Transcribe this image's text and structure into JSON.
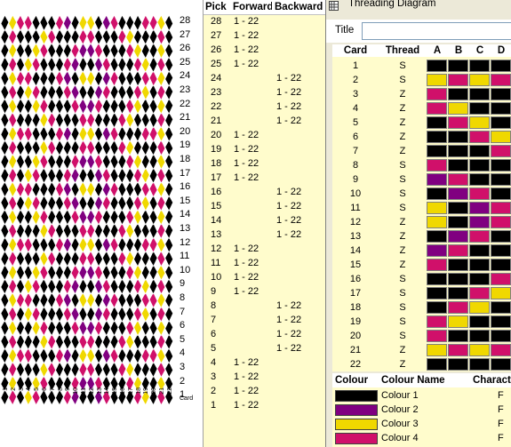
{
  "pattern": {
    "pick_labels": [
      "28",
      "27",
      "26",
      "25",
      "24",
      "23",
      "22",
      "21",
      "20",
      "19",
      "18",
      "17",
      "16",
      "15",
      "14",
      "13",
      "12",
      "11",
      "10",
      "9",
      "8",
      "7",
      "6",
      "5",
      "4",
      "3",
      "2",
      "1"
    ],
    "card_labels": [
      "1",
      "2",
      "3",
      "4",
      "5",
      "6",
      "7",
      "8",
      "9",
      "10",
      "11",
      "12",
      "13",
      "14",
      "15",
      "16",
      "17",
      "18",
      "19",
      "20",
      "21",
      "22"
    ],
    "card_word": "Card"
  },
  "pick_table": {
    "headers": [
      "Pick",
      "Forward",
      "Backward"
    ],
    "rows": [
      {
        "pick": "28",
        "fwd": "1 - 22",
        "bwd": ""
      },
      {
        "pick": "27",
        "fwd": "1 - 22",
        "bwd": ""
      },
      {
        "pick": "26",
        "fwd": "1 - 22",
        "bwd": ""
      },
      {
        "pick": "25",
        "fwd": "1 - 22",
        "bwd": ""
      },
      {
        "pick": "24",
        "fwd": "",
        "bwd": "1 - 22"
      },
      {
        "pick": "23",
        "fwd": "",
        "bwd": "1 - 22"
      },
      {
        "pick": "22",
        "fwd": "",
        "bwd": "1 - 22"
      },
      {
        "pick": "21",
        "fwd": "",
        "bwd": "1 - 22"
      },
      {
        "pick": "20",
        "fwd": "1 - 22",
        "bwd": ""
      },
      {
        "pick": "19",
        "fwd": "1 - 22",
        "bwd": ""
      },
      {
        "pick": "18",
        "fwd": "1 - 22",
        "bwd": ""
      },
      {
        "pick": "17",
        "fwd": "1 - 22",
        "bwd": ""
      },
      {
        "pick": "16",
        "fwd": "",
        "bwd": "1 - 22"
      },
      {
        "pick": "15",
        "fwd": "",
        "bwd": "1 - 22"
      },
      {
        "pick": "14",
        "fwd": "",
        "bwd": "1 - 22"
      },
      {
        "pick": "13",
        "fwd": "",
        "bwd": "1 - 22"
      },
      {
        "pick": "12",
        "fwd": "1 - 22",
        "bwd": ""
      },
      {
        "pick": "11",
        "fwd": "1 - 22",
        "bwd": ""
      },
      {
        "pick": "10",
        "fwd": "1 - 22",
        "bwd": ""
      },
      {
        "pick": "9",
        "fwd": "1 - 22",
        "bwd": ""
      },
      {
        "pick": "8",
        "fwd": "",
        "bwd": "1 - 22"
      },
      {
        "pick": "7",
        "fwd": "",
        "bwd": "1 - 22"
      },
      {
        "pick": "6",
        "fwd": "",
        "bwd": "1 - 22"
      },
      {
        "pick": "5",
        "fwd": "",
        "bwd": "1 - 22"
      },
      {
        "pick": "4",
        "fwd": "1 - 22",
        "bwd": ""
      },
      {
        "pick": "3",
        "fwd": "1 - 22",
        "bwd": ""
      },
      {
        "pick": "2",
        "fwd": "1 - 22",
        "bwd": ""
      },
      {
        "pick": "1",
        "fwd": "1 - 22",
        "bwd": ""
      }
    ]
  },
  "threading": {
    "window_title": "Threading Diagram",
    "title_label": "Title",
    "title_value": "",
    "headers": [
      "Card",
      "Thread",
      "A",
      "B",
      "C",
      "D"
    ],
    "rows": [
      {
        "card": "1",
        "thread": "S",
        "holes": [
          1,
          1,
          1,
          1
        ]
      },
      {
        "card": "2",
        "thread": "S",
        "holes": [
          3,
          4,
          3,
          4
        ]
      },
      {
        "card": "3",
        "thread": "Z",
        "holes": [
          4,
          1,
          1,
          1
        ]
      },
      {
        "card": "4",
        "thread": "Z",
        "holes": [
          4,
          3,
          1,
          1
        ]
      },
      {
        "card": "5",
        "thread": "Z",
        "holes": [
          1,
          4,
          3,
          1
        ]
      },
      {
        "card": "6",
        "thread": "Z",
        "holes": [
          1,
          1,
          4,
          3
        ]
      },
      {
        "card": "7",
        "thread": "Z",
        "holes": [
          1,
          1,
          1,
          4
        ]
      },
      {
        "card": "8",
        "thread": "S",
        "holes": [
          4,
          1,
          1,
          1
        ]
      },
      {
        "card": "9",
        "thread": "S",
        "holes": [
          2,
          4,
          1,
          1
        ]
      },
      {
        "card": "10",
        "thread": "S",
        "holes": [
          1,
          2,
          4,
          1
        ]
      },
      {
        "card": "11",
        "thread": "S",
        "holes": [
          3,
          1,
          2,
          4
        ]
      },
      {
        "card": "12",
        "thread": "Z",
        "holes": [
          3,
          1,
          2,
          4
        ]
      },
      {
        "card": "13",
        "thread": "Z",
        "holes": [
          1,
          2,
          4,
          1
        ]
      },
      {
        "card": "14",
        "thread": "Z",
        "holes": [
          2,
          4,
          1,
          1
        ]
      },
      {
        "card": "15",
        "thread": "Z",
        "holes": [
          4,
          1,
          1,
          1
        ]
      },
      {
        "card": "16",
        "thread": "S",
        "holes": [
          1,
          1,
          1,
          4
        ]
      },
      {
        "card": "17",
        "thread": "S",
        "holes": [
          1,
          1,
          4,
          3
        ]
      },
      {
        "card": "18",
        "thread": "S",
        "holes": [
          1,
          4,
          3,
          1
        ]
      },
      {
        "card": "19",
        "thread": "S",
        "holes": [
          4,
          3,
          1,
          1
        ]
      },
      {
        "card": "20",
        "thread": "S",
        "holes": [
          4,
          1,
          1,
          1
        ]
      },
      {
        "card": "21",
        "thread": "Z",
        "holes": [
          3,
          4,
          3,
          4
        ]
      },
      {
        "card": "22",
        "thread": "Z",
        "holes": [
          1,
          1,
          1,
          1
        ]
      }
    ],
    "colour_headers": [
      "Colour",
      "Colour Name",
      "Character"
    ],
    "colours": [
      {
        "name": "Colour 1",
        "hex": "#000000",
        "char": "F"
      },
      {
        "name": "Colour 2",
        "hex": "#800080",
        "char": "F"
      },
      {
        "name": "Colour 3",
        "hex": "#f0d800",
        "char": "F"
      },
      {
        "name": "Colour 4",
        "hex": "#d0106a",
        "char": "F"
      }
    ]
  }
}
